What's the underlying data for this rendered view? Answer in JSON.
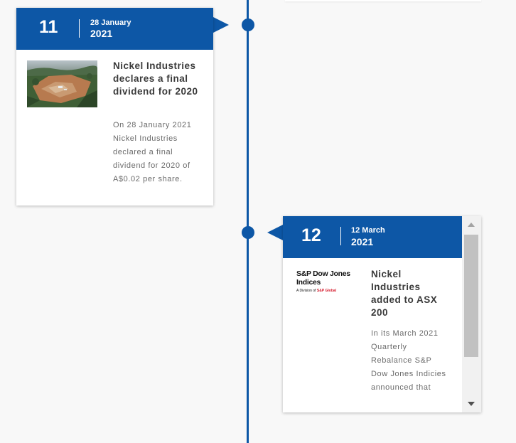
{
  "timeline": {
    "entries": [
      {
        "number": "11",
        "date_day": "28 January",
        "date_year": "2021",
        "title": "Nickel Industries declares a final dividend for 2020",
        "body": "On 28 January 2021 Nickel Industries declared a final dividend for 2020 of A$0.02 per share."
      },
      {
        "number": "12",
        "date_day": "12 March",
        "date_year": "2021",
        "title": "Nickel Industries added to ASX 200",
        "body": "In its March 2021 Quarterly Rebalance S&P Dow Jones Indicies announced that",
        "logo": {
          "line1": "S&P Dow Jones",
          "line2": "Indices",
          "sub_prefix": "A Division of ",
          "sub_brand": "S&P Global"
        }
      }
    ]
  },
  "colors": {
    "accent": "#0d57a6",
    "background": "#f8f8f8",
    "card": "#ffffff"
  }
}
